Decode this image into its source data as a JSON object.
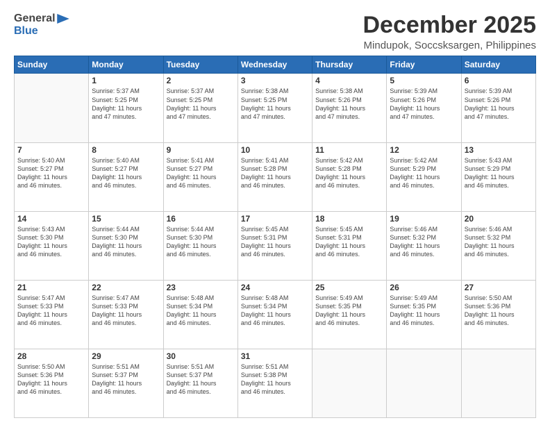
{
  "logo": {
    "general": "General",
    "blue": "Blue"
  },
  "title": "December 2025",
  "subtitle": "Mindupok, Soccsksargen, Philippines",
  "days_of_week": [
    "Sunday",
    "Monday",
    "Tuesday",
    "Wednesday",
    "Thursday",
    "Friday",
    "Saturday"
  ],
  "weeks": [
    [
      {
        "day": "",
        "info": ""
      },
      {
        "day": "1",
        "info": "Sunrise: 5:37 AM\nSunset: 5:25 PM\nDaylight: 11 hours\nand 47 minutes."
      },
      {
        "day": "2",
        "info": "Sunrise: 5:37 AM\nSunset: 5:25 PM\nDaylight: 11 hours\nand 47 minutes."
      },
      {
        "day": "3",
        "info": "Sunrise: 5:38 AM\nSunset: 5:25 PM\nDaylight: 11 hours\nand 47 minutes."
      },
      {
        "day": "4",
        "info": "Sunrise: 5:38 AM\nSunset: 5:26 PM\nDaylight: 11 hours\nand 47 minutes."
      },
      {
        "day": "5",
        "info": "Sunrise: 5:39 AM\nSunset: 5:26 PM\nDaylight: 11 hours\nand 47 minutes."
      },
      {
        "day": "6",
        "info": "Sunrise: 5:39 AM\nSunset: 5:26 PM\nDaylight: 11 hours\nand 47 minutes."
      }
    ],
    [
      {
        "day": "7",
        "info": "Sunrise: 5:40 AM\nSunset: 5:27 PM\nDaylight: 11 hours\nand 46 minutes."
      },
      {
        "day": "8",
        "info": "Sunrise: 5:40 AM\nSunset: 5:27 PM\nDaylight: 11 hours\nand 46 minutes."
      },
      {
        "day": "9",
        "info": "Sunrise: 5:41 AM\nSunset: 5:27 PM\nDaylight: 11 hours\nand 46 minutes."
      },
      {
        "day": "10",
        "info": "Sunrise: 5:41 AM\nSunset: 5:28 PM\nDaylight: 11 hours\nand 46 minutes."
      },
      {
        "day": "11",
        "info": "Sunrise: 5:42 AM\nSunset: 5:28 PM\nDaylight: 11 hours\nand 46 minutes."
      },
      {
        "day": "12",
        "info": "Sunrise: 5:42 AM\nSunset: 5:29 PM\nDaylight: 11 hours\nand 46 minutes."
      },
      {
        "day": "13",
        "info": "Sunrise: 5:43 AM\nSunset: 5:29 PM\nDaylight: 11 hours\nand 46 minutes."
      }
    ],
    [
      {
        "day": "14",
        "info": "Sunrise: 5:43 AM\nSunset: 5:30 PM\nDaylight: 11 hours\nand 46 minutes."
      },
      {
        "day": "15",
        "info": "Sunrise: 5:44 AM\nSunset: 5:30 PM\nDaylight: 11 hours\nand 46 minutes."
      },
      {
        "day": "16",
        "info": "Sunrise: 5:44 AM\nSunset: 5:30 PM\nDaylight: 11 hours\nand 46 minutes."
      },
      {
        "day": "17",
        "info": "Sunrise: 5:45 AM\nSunset: 5:31 PM\nDaylight: 11 hours\nand 46 minutes."
      },
      {
        "day": "18",
        "info": "Sunrise: 5:45 AM\nSunset: 5:31 PM\nDaylight: 11 hours\nand 46 minutes."
      },
      {
        "day": "19",
        "info": "Sunrise: 5:46 AM\nSunset: 5:32 PM\nDaylight: 11 hours\nand 46 minutes."
      },
      {
        "day": "20",
        "info": "Sunrise: 5:46 AM\nSunset: 5:32 PM\nDaylight: 11 hours\nand 46 minutes."
      }
    ],
    [
      {
        "day": "21",
        "info": "Sunrise: 5:47 AM\nSunset: 5:33 PM\nDaylight: 11 hours\nand 46 minutes."
      },
      {
        "day": "22",
        "info": "Sunrise: 5:47 AM\nSunset: 5:33 PM\nDaylight: 11 hours\nand 46 minutes."
      },
      {
        "day": "23",
        "info": "Sunrise: 5:48 AM\nSunset: 5:34 PM\nDaylight: 11 hours\nand 46 minutes."
      },
      {
        "day": "24",
        "info": "Sunrise: 5:48 AM\nSunset: 5:34 PM\nDaylight: 11 hours\nand 46 minutes."
      },
      {
        "day": "25",
        "info": "Sunrise: 5:49 AM\nSunset: 5:35 PM\nDaylight: 11 hours\nand 46 minutes."
      },
      {
        "day": "26",
        "info": "Sunrise: 5:49 AM\nSunset: 5:35 PM\nDaylight: 11 hours\nand 46 minutes."
      },
      {
        "day": "27",
        "info": "Sunrise: 5:50 AM\nSunset: 5:36 PM\nDaylight: 11 hours\nand 46 minutes."
      }
    ],
    [
      {
        "day": "28",
        "info": "Sunrise: 5:50 AM\nSunset: 5:36 PM\nDaylight: 11 hours\nand 46 minutes."
      },
      {
        "day": "29",
        "info": "Sunrise: 5:51 AM\nSunset: 5:37 PM\nDaylight: 11 hours\nand 46 minutes."
      },
      {
        "day": "30",
        "info": "Sunrise: 5:51 AM\nSunset: 5:37 PM\nDaylight: 11 hours\nand 46 minutes."
      },
      {
        "day": "31",
        "info": "Sunrise: 5:51 AM\nSunset: 5:38 PM\nDaylight: 11 hours\nand 46 minutes."
      },
      {
        "day": "",
        "info": ""
      },
      {
        "day": "",
        "info": ""
      },
      {
        "day": "",
        "info": ""
      }
    ]
  ]
}
